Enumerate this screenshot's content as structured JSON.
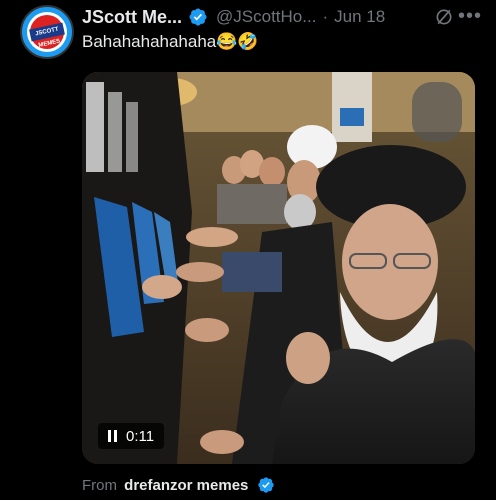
{
  "tweet": {
    "avatar_text": "JSCOTT MEMES",
    "display_name": "JScott Me...",
    "handle": "@JScottHo...",
    "separator": "·",
    "date": "Jun 18",
    "text": "Bahahahahahaha😂🤣",
    "more_label": "•••"
  },
  "video": {
    "time": "0:11"
  },
  "source": {
    "from_label": "From",
    "name": "drefanzor memes"
  },
  "colors": {
    "background": "#000000",
    "text": "#e7e9ea",
    "muted": "#71767b",
    "verified": "#1d9bf0"
  }
}
